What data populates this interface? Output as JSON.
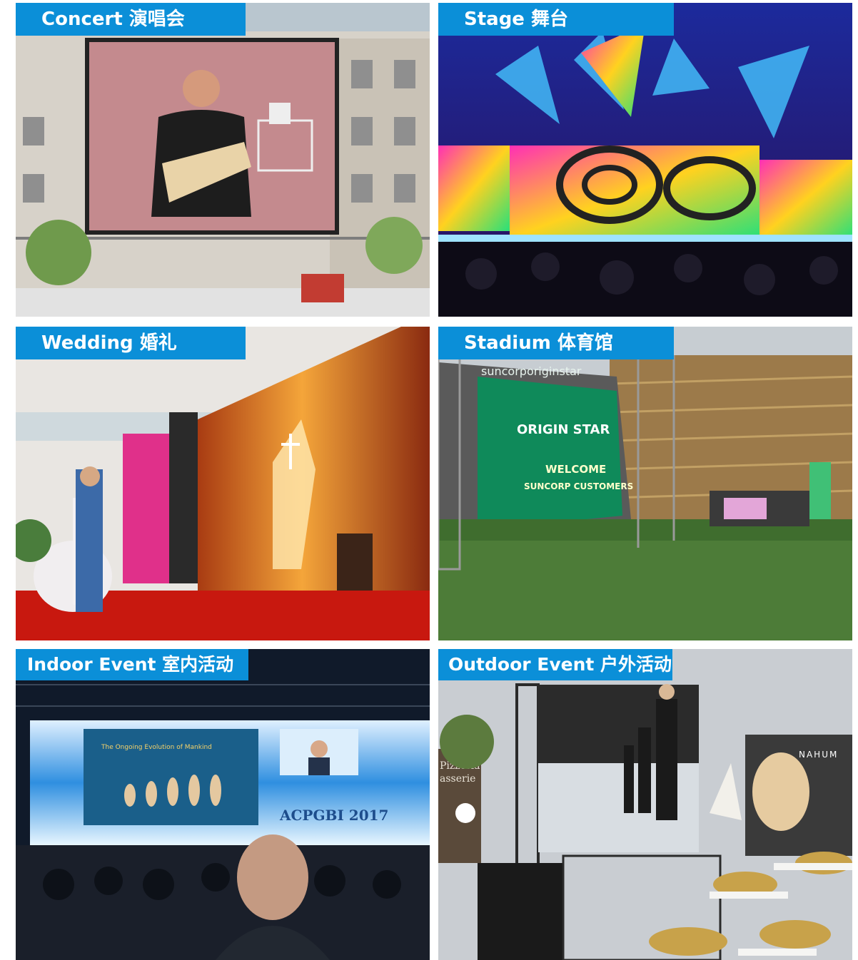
{
  "panels": [
    {
      "label": "Concert 演唱会"
    },
    {
      "label": "Stage 舞台"
    },
    {
      "label": "Wedding 婚礼"
    },
    {
      "label": "Stadium 体育馆"
    },
    {
      "label": "Indoor Event 室内活动"
    },
    {
      "label": "Outdoor Event 户外活动"
    }
  ],
  "screens": {
    "stadium_top": "suncorporiginstar",
    "stadium_brand": "ORIGIN STAR",
    "stadium_welcome": "WELCOME",
    "stadium_sub": "SUNCORP CUSTOMERS",
    "indoor_slide_title": "The Ongoing Evolution of Mankind",
    "indoor_event": "ACPGBI 2017",
    "outdoor_sign1": "Pizzeria",
    "outdoor_sign2": "asserie",
    "outdoor_brand": "NAHUM"
  },
  "colors": {
    "label_bg": "#0b8fd8"
  }
}
